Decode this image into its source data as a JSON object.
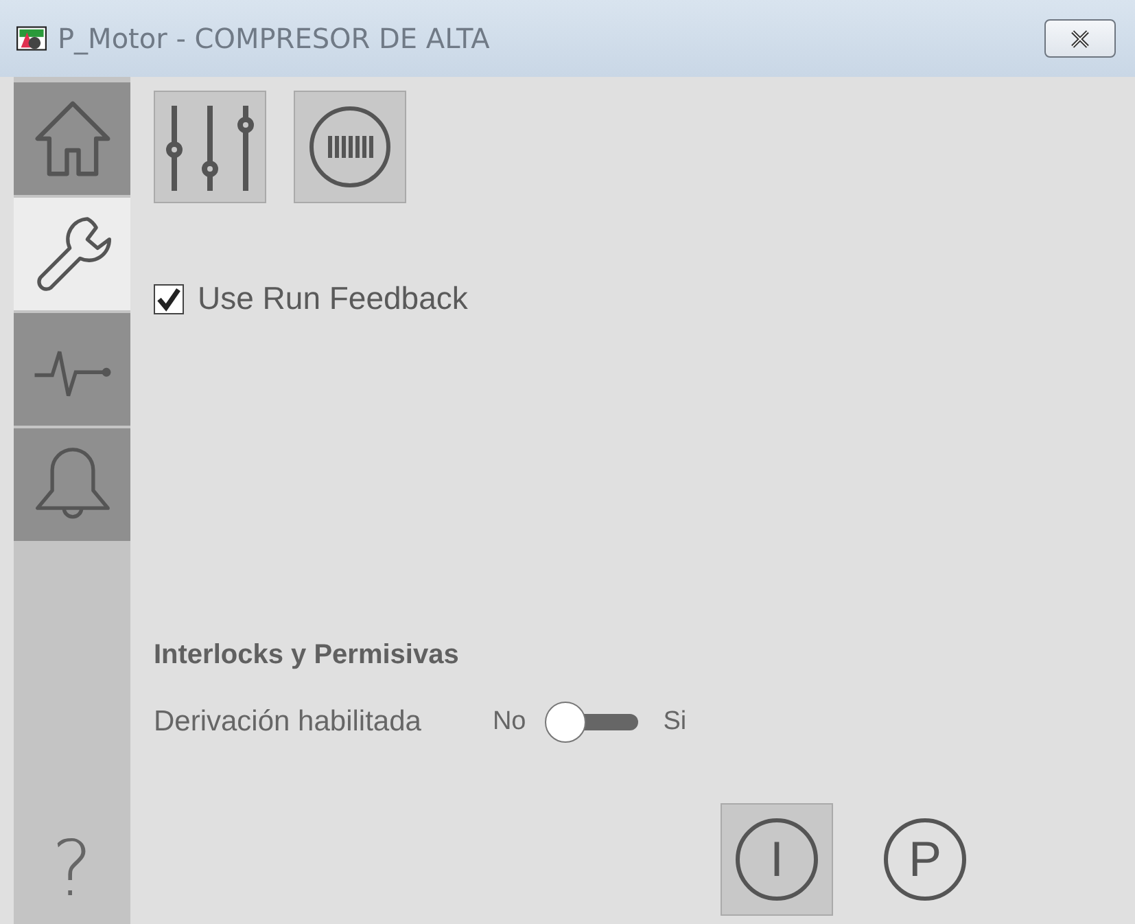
{
  "window": {
    "title": "P_Motor - COMPRESOR DE ALTA"
  },
  "nav_tabs": [
    {
      "kind": "home",
      "selected": false
    },
    {
      "kind": "wrench",
      "selected": true
    },
    {
      "kind": "pulse",
      "selected": false
    },
    {
      "kind": "bell",
      "selected": false
    }
  ],
  "help": "?",
  "toolbar": [
    {
      "kind": "sliders"
    },
    {
      "kind": "barcode"
    }
  ],
  "use_run_feedback": {
    "label": "Use Run Feedback",
    "checked": true
  },
  "interlocks": {
    "title": "Interlocks y Permisivas",
    "bypass": {
      "label": "Derivación habilitada",
      "off_label": "No",
      "on_label": "Si",
      "on": false
    }
  },
  "modes": [
    {
      "letter": "I",
      "selected": true
    },
    {
      "letter": "P",
      "selected": false
    }
  ]
}
